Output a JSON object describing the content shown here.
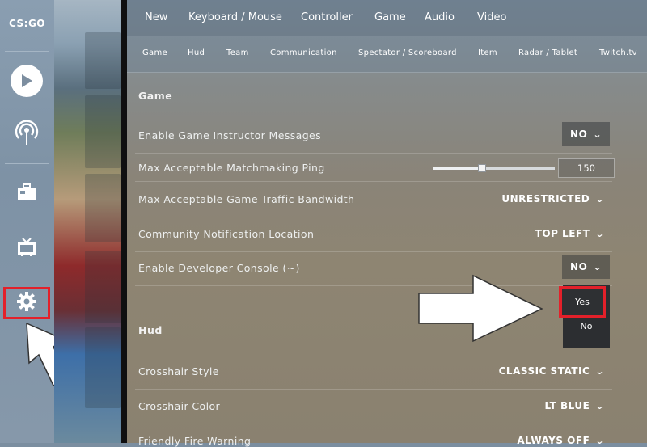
{
  "app": {
    "logo_text": "CS:GO"
  },
  "sidebar": {
    "items": [
      {
        "name": "play",
        "icon": "play-icon"
      },
      {
        "name": "broadcast",
        "icon": "broadcast-icon"
      },
      {
        "name": "inventory",
        "icon": "briefcase-icon"
      },
      {
        "name": "watch",
        "icon": "tv-icon"
      },
      {
        "name": "settings",
        "icon": "gear-icon",
        "highlight_color": "#e3202a"
      }
    ]
  },
  "tabs": [
    "New",
    "Keyboard / Mouse",
    "Controller",
    "Game",
    "Audio",
    "Video"
  ],
  "subtabs": [
    "Game",
    "Hud",
    "Team",
    "Communication",
    "Spectator / Scoreboard",
    "Item",
    "Radar / Tablet",
    "Twitch.tv"
  ],
  "sections": {
    "game": {
      "title": "Game",
      "rows": [
        {
          "label": "Enable Game Instructor Messages",
          "value": "NO"
        },
        {
          "label": "Max Acceptable Matchmaking Ping",
          "value": "150",
          "slider_fraction": 0.4
        },
        {
          "label": "Max Acceptable Game Traffic Bandwidth",
          "value": "UNRESTRICTED"
        },
        {
          "label": "Community Notification Location",
          "value": "TOP LEFT"
        },
        {
          "label": "Enable Developer Console (~)",
          "value": "NO"
        }
      ]
    },
    "hud": {
      "title": "Hud",
      "rows": [
        {
          "label": "Crosshair Style",
          "value": "CLASSIC STATIC"
        },
        {
          "label": "Crosshair Color",
          "value": "LT BLUE"
        },
        {
          "label": "Friendly Fire Warning",
          "value": "ALWAYS OFF"
        }
      ]
    }
  },
  "dropdown": {
    "options": [
      "Yes",
      "No"
    ],
    "highlight_color": "#e3202a"
  },
  "colors": {
    "annotation": "#e3202a",
    "arrow_fill": "#ffffff"
  }
}
